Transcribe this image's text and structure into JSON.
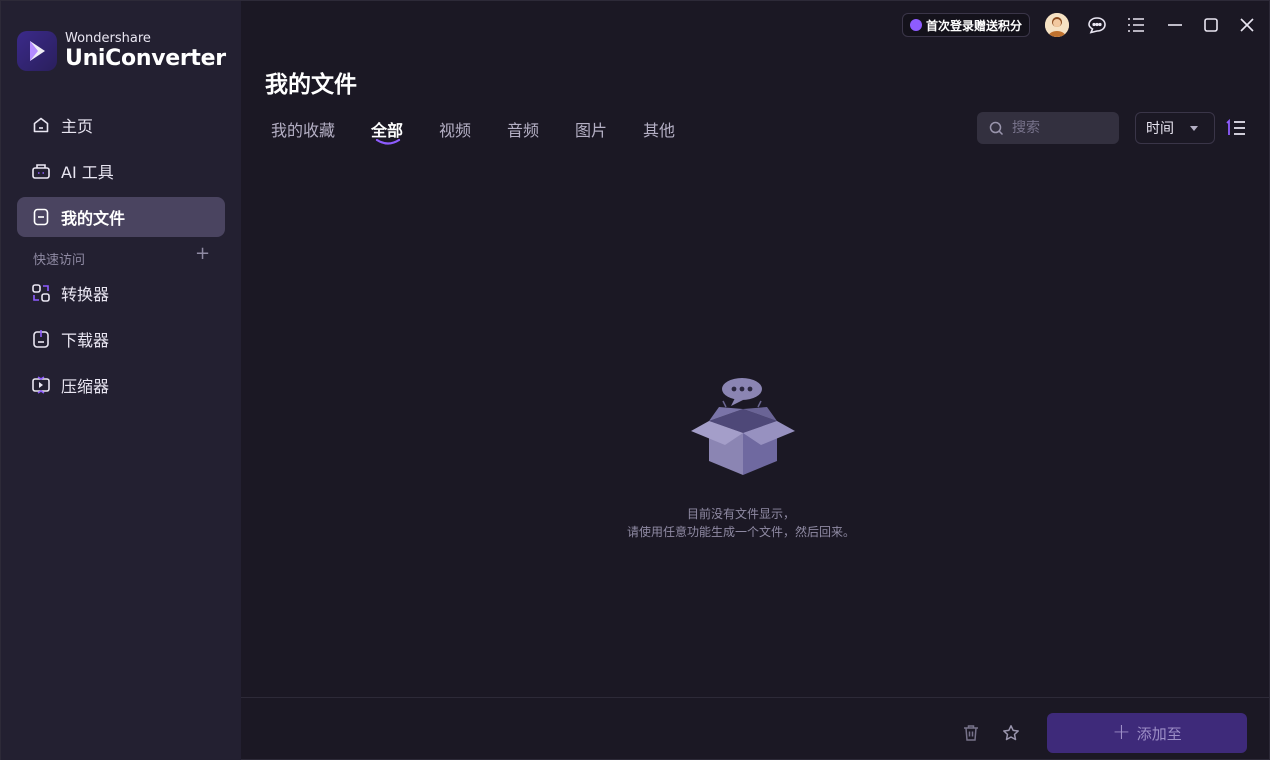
{
  "app": {
    "brand": "Wondershare",
    "product": "UniConverter"
  },
  "topbar": {
    "promo_label": "首次登录赠送积分",
    "icons": [
      "avatar",
      "feedback-icon",
      "menu-icon",
      "minimize-icon",
      "maximize-icon",
      "close-icon"
    ]
  },
  "sidebar": {
    "items": [
      {
        "label": "主页",
        "icon": "home-icon"
      },
      {
        "label": "AI 工具",
        "icon": "ai-tools-icon"
      },
      {
        "label": "我的文件",
        "icon": "my-files-icon",
        "active": true
      }
    ],
    "quick_access_label": "快速访问",
    "quick_items": [
      {
        "label": "转换器",
        "icon": "converter-icon"
      },
      {
        "label": "下载器",
        "icon": "downloader-icon"
      },
      {
        "label": "压缩器",
        "icon": "compressor-icon"
      }
    ]
  },
  "main": {
    "title": "我的文件",
    "tabs": [
      {
        "label": "我的收藏"
      },
      {
        "label": "全部",
        "active": true
      },
      {
        "label": "视频"
      },
      {
        "label": "音频"
      },
      {
        "label": "图片"
      },
      {
        "label": "其他"
      }
    ],
    "search_placeholder": "搜索",
    "sort_value": "时间",
    "empty_line1": "目前没有文件显示，",
    "empty_line2": "请使用任意功能生成一个文件，然后回来。"
  },
  "footer": {
    "add_label": "添加至"
  },
  "colors": {
    "accent": "#8e5cff",
    "sidebar_bg": "#232031",
    "main_bg": "#1b1824",
    "active_nav": "#4a4460",
    "add_button": "#3e2a7a"
  }
}
